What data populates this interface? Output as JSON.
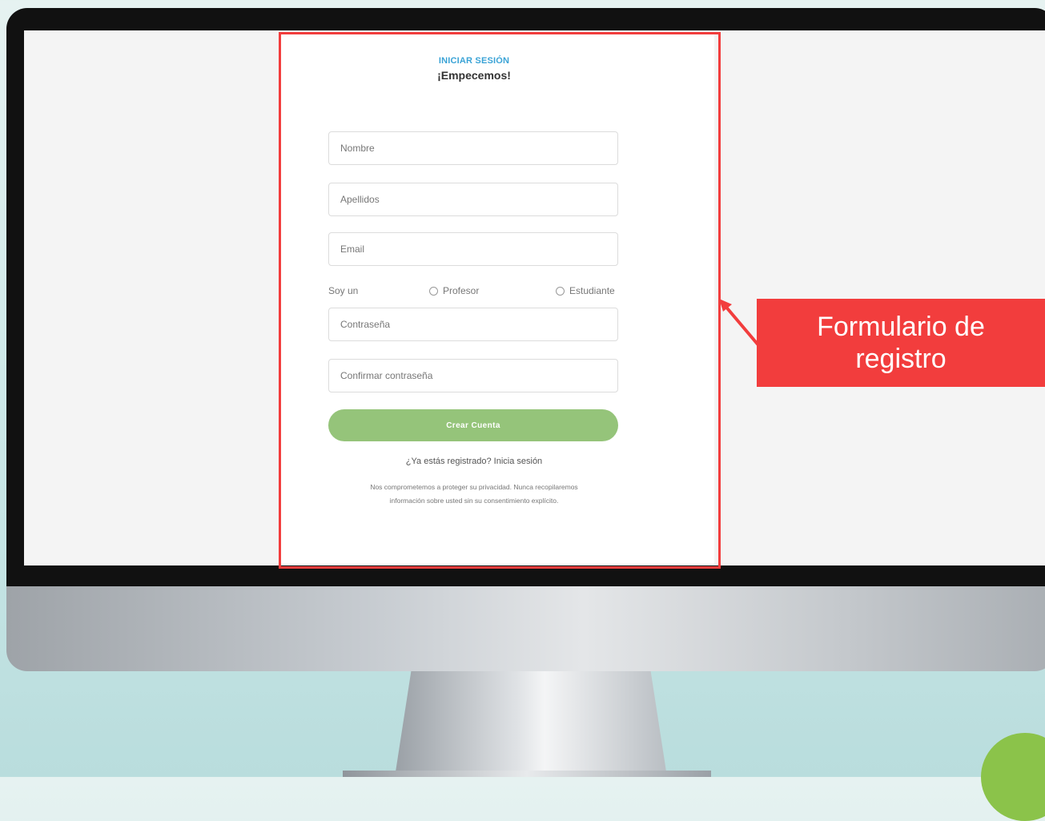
{
  "form": {
    "overline": "INICIAR SESIÓN",
    "heading": "¡Empecemos!",
    "fields": {
      "nombre": "Nombre",
      "apellidos": "Apellidos",
      "email": "Email",
      "contrasena": "Contraseña",
      "confirmar": "Confirmar contraseña"
    },
    "role": {
      "label": "Soy un",
      "option_1": "Profesor",
      "option_2": "Estudiante"
    },
    "submit_label": "Crear Cuenta",
    "login_link": "¿Ya estás registrado? Inicia sesión",
    "privacy_text": "Nos comprometemos a proteger su privacidad. Nunca recopilaremos información sobre usted sin su consentimiento explícito."
  },
  "callout": {
    "line_1": "Formulario de",
    "line_2": "registro"
  },
  "colors": {
    "frame": "#f23d3d",
    "accent_blue": "#3aa3d6",
    "button_green": "#95c47a"
  }
}
